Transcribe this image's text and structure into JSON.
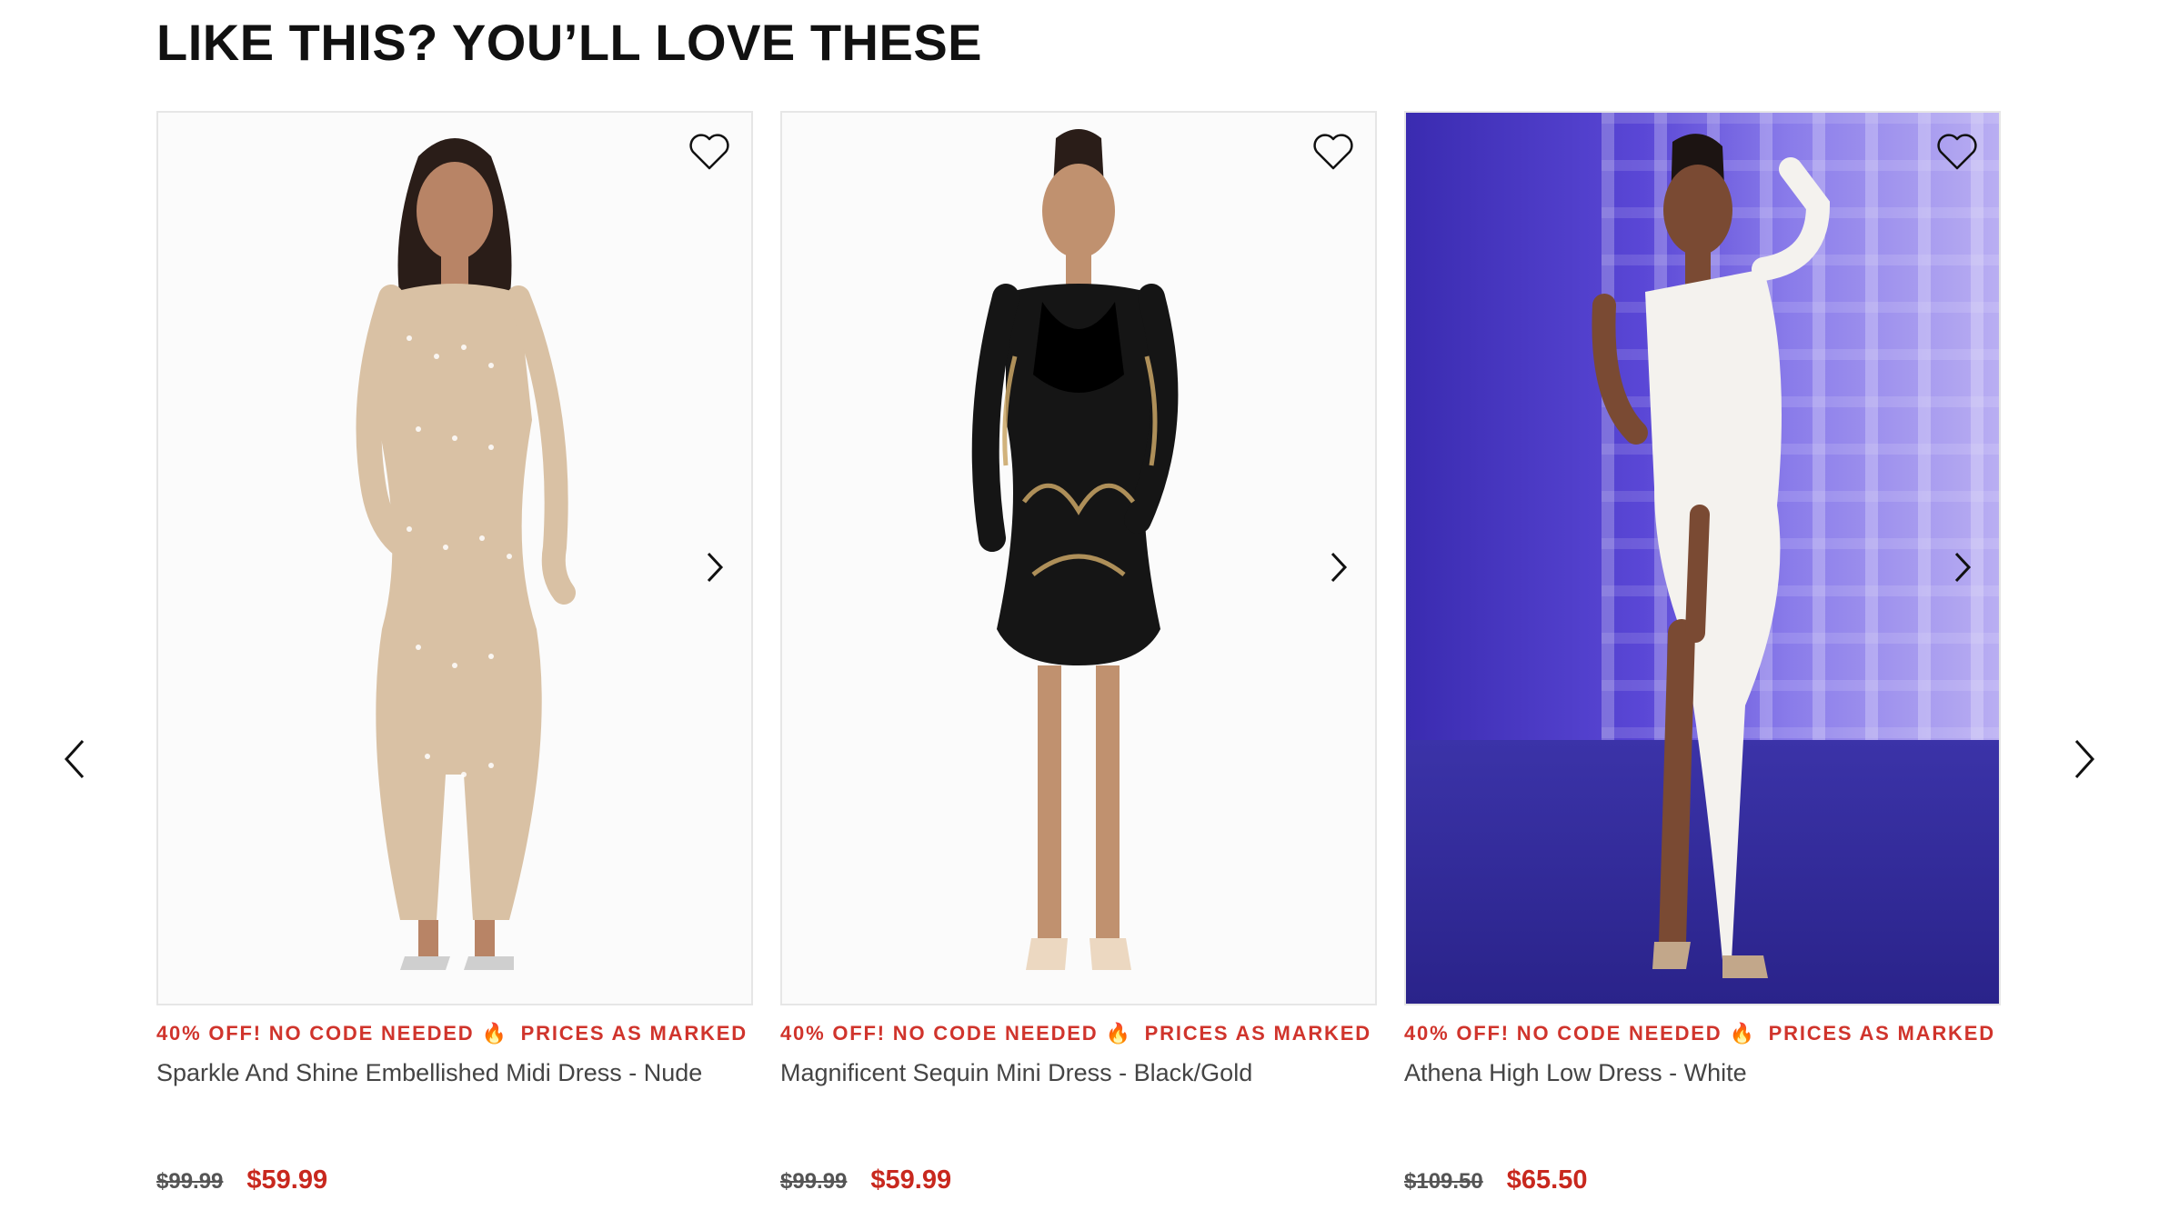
{
  "section": {
    "heading": "LIKE THIS? YOU’LL LOVE THESE"
  },
  "products": [
    {
      "promo": "40% OFF! NO CODE NEEDED",
      "promo_icon": "fire-icon",
      "promo_suffix": "PRICES AS MARKED",
      "title": "Sparkle And Shine Embellished Midi Dress - Nude",
      "old_price": "$99.99",
      "new_price": "$59.99"
    },
    {
      "promo": "40% OFF! NO CODE NEEDED",
      "promo_icon": "fire-icon",
      "promo_suffix": "PRICES AS MARKED",
      "title": "Magnificent Sequin Mini Dress - Black/Gold",
      "old_price": "$99.99",
      "new_price": "$59.99"
    },
    {
      "promo": "40% OFF! NO CODE NEEDED",
      "promo_icon": "fire-icon",
      "promo_suffix": "PRICES AS MARKED",
      "title": "Athena High Low Dress - White",
      "old_price": "$109.50",
      "new_price": "$65.50"
    }
  ],
  "colors": {
    "promo": "#d0342c",
    "sale_price": "#c8281e",
    "border": "#e6e6e6"
  }
}
